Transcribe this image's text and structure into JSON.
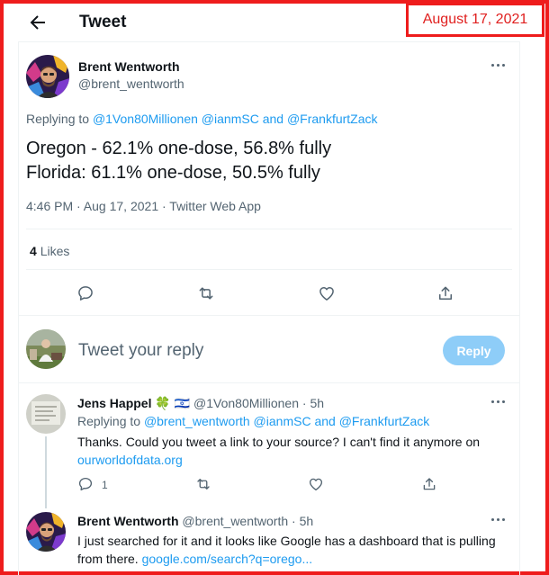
{
  "date_stamp": "August 17, 2021",
  "header": {
    "title": "Tweet"
  },
  "main_tweet": {
    "author_name": "Brent Wentworth",
    "author_handle": "@brent_wentworth",
    "replying_prefix": "Replying to",
    "replying_to_1": "@1Von80Millionen",
    "replying_to_2": "@ianmSC",
    "replying_and": "and",
    "replying_to_3": "@FrankfurtZack",
    "text_line1": "Oregon - 62.1% one-dose, 56.8% fully",
    "text_line2": "Florida: 61.1% one-dose, 50.5% fully",
    "timestamp": "4:46 PM · Aug 17, 2021 · Twitter Web App",
    "likes_count": "4",
    "likes_label": "Likes"
  },
  "compose": {
    "placeholder": "Tweet your reply",
    "button_label": "Reply"
  },
  "replies": [
    {
      "author_name": "Jens Happel",
      "emojis": "🍀 🇮🇱",
      "author_handle": "@1Von80Millionen",
      "time": "· 5h",
      "replying_prefix": "Replying to",
      "replying_to_1": "@brent_wentworth",
      "replying_to_2": "@ianmSC",
      "replying_and": "and",
      "replying_to_3": "@FrankfurtZack",
      "text_line1": "Thanks. Could you tweet a link to your source? I can't find it anymore on",
      "text_link": "ourworldofdata.org",
      "reply_count": "1"
    },
    {
      "author_name": "Brent Wentworth",
      "author_handle": "@brent_wentworth",
      "time": "· 5h",
      "text_line1": "I just searched for it and it looks like Google has a dashboard that is pulling",
      "text_line2_prefix": "from there.",
      "text_link": "google.com/search?q=orego..."
    }
  ],
  "icons": [
    "back-arrow-icon",
    "more-icon",
    "reply-icon",
    "retweet-icon",
    "like-icon",
    "share-icon"
  ],
  "colors": {
    "accent": "#1d9bf0",
    "annotation_red": "#ee1c1c",
    "text": "#0f1419",
    "secondary": "#536471"
  }
}
